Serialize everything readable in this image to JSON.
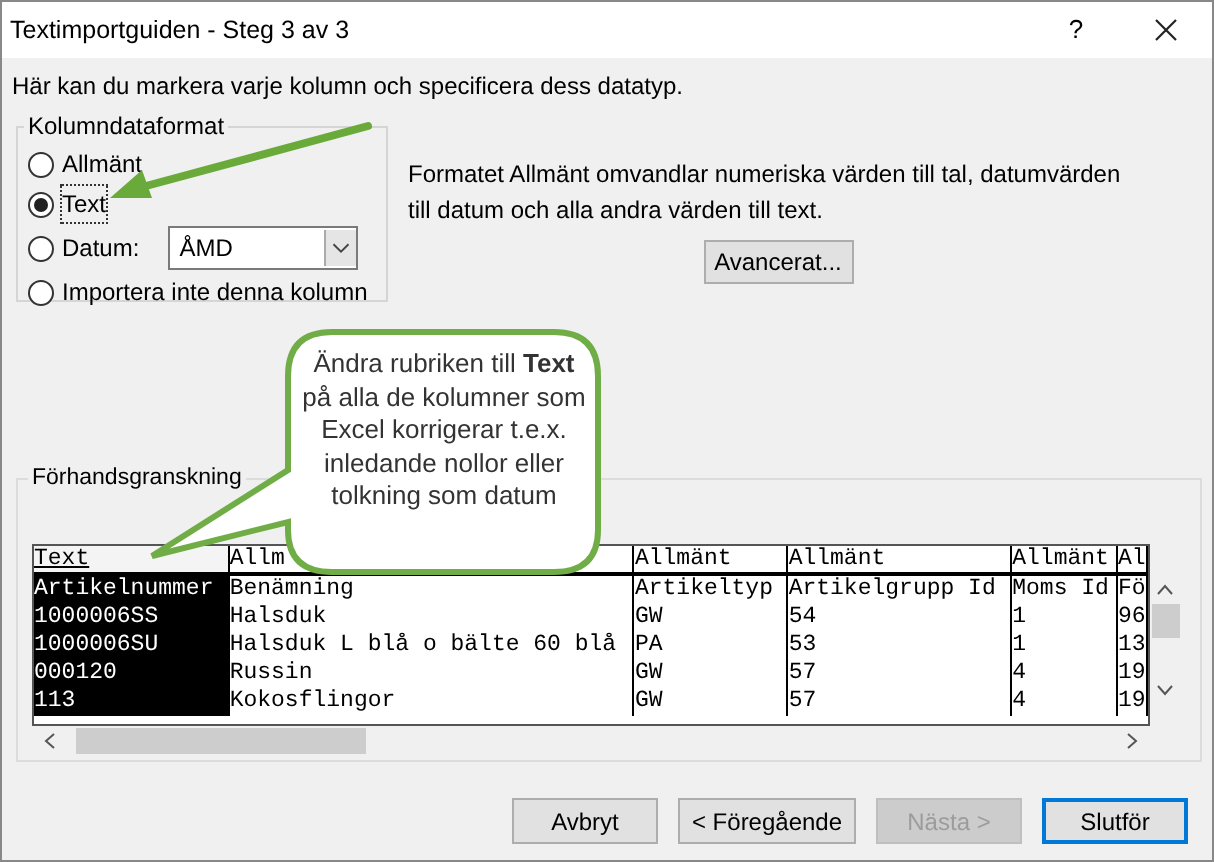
{
  "window": {
    "title": "Textimportguiden - Steg 3 av 3",
    "help": "?"
  },
  "instruction": "Här kan du markera varje kolumn och specificera dess datatyp.",
  "column_format": {
    "title": "Kolumndataformat",
    "options": [
      {
        "label": "Allmänt",
        "selected": false
      },
      {
        "label": "Text",
        "selected": true
      },
      {
        "label": "Datum:",
        "selected": false,
        "kind": "date",
        "dropdown": "ÅMD"
      },
      {
        "label": "Importera inte denna kolumn",
        "selected": false
      }
    ]
  },
  "description": "Formatet Allmänt omvandlar numeriska värden till tal, datumvärden till datum och alla andra värden till text.",
  "advanced_button": "Avancerat...",
  "callout": "Ändra rubriken till **Text** på alla de kolumner som Excel korrigerar t.e.x. inledande nollor eller tolkning som datum",
  "preview": {
    "title": "Förhandsgranskning",
    "columns": [
      {
        "header": "Text",
        "selected": true
      },
      {
        "header": "Allm",
        "selected": false
      },
      {
        "header": "Allmänt",
        "selected": false
      },
      {
        "header": "Allmänt",
        "selected": false
      },
      {
        "header": "Allmänt",
        "selected": false
      },
      {
        "header": "Al",
        "selected": false
      }
    ],
    "rows": [
      [
        "Artikelnummer",
        "Benämning",
        "Artikeltyp",
        "Artikelgrupp Id",
        "Moms Id",
        "Fö"
      ],
      [
        "1000006SS",
        "Halsduk",
        "GW",
        "54",
        "1",
        "96"
      ],
      [
        "1000006SU",
        "Halsduk L blå o bälte 60 blå",
        "PA",
        "53",
        "1",
        "13"
      ],
      [
        "000120",
        "Russin",
        "GW",
        "57",
        "4",
        "19"
      ],
      [
        "113",
        "Kokosflingor",
        "GW",
        "57",
        "4",
        "19"
      ]
    ]
  },
  "buttons": [
    {
      "label": "Avbryt",
      "disabled": false,
      "default": false
    },
    {
      "label": "< Föregående",
      "disabled": false,
      "default": false
    },
    {
      "label": "Nästa >",
      "disabled": true,
      "default": false
    },
    {
      "label": "Slutför",
      "disabled": false,
      "default": true
    }
  ]
}
